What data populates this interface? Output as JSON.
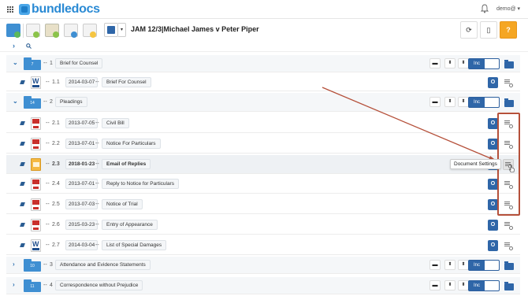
{
  "app": {
    "logo_text": "bundledocs",
    "user_label": "demo@ ▾",
    "doc_title": "JAM 12/3|Michael James v Peter Piper",
    "tooltip": "Document Settings"
  },
  "rows": [
    {
      "type": "section",
      "num": "1",
      "folder": "7",
      "label": "Brief for Counsel"
    },
    {
      "type": "doc",
      "file": "word",
      "num": "1.1",
      "date": "2014-03-07",
      "label": "Brief For Counsel"
    },
    {
      "type": "section",
      "num": "2",
      "folder": "14",
      "label": "Pleadings"
    },
    {
      "type": "doc",
      "file": "pdf",
      "num": "2.1",
      "date": "2013-07-05",
      "label": "Civil Bill"
    },
    {
      "type": "doc",
      "file": "pdf",
      "num": "2.2",
      "date": "2013-07-01",
      "label": "Notice For Particulars"
    },
    {
      "type": "doc",
      "file": "email",
      "num": "2.3",
      "date": "2018-01-23",
      "label": "Email of Replies"
    },
    {
      "type": "doc",
      "file": "pdf",
      "num": "2.4",
      "date": "2013-07-01",
      "label": "Reply to Notice for Particulars"
    },
    {
      "type": "doc",
      "file": "pdf",
      "num": "2.5",
      "date": "2013-07-03",
      "label": "Notice of Trial"
    },
    {
      "type": "doc",
      "file": "pdf",
      "num": "2.6",
      "date": "2015-03-23",
      "label": "Entry of Appearance"
    },
    {
      "type": "doc",
      "file": "word",
      "num": "2.7",
      "date": "2014-03-04",
      "label": "List of Special Damages"
    },
    {
      "type": "section",
      "num": "3",
      "folder": "10",
      "label": "Attendance and Evidence Statements"
    },
    {
      "type": "section",
      "num": "4",
      "folder": "11",
      "label": "Correspondence without Prejudice"
    }
  ],
  "labels": {
    "inc": "Inc",
    "toggle": "O",
    "word_letter": "W",
    "chev_down": "⌄",
    "chev_right": "›",
    "dash": "--",
    "date_dash": "--",
    "speech": "▬",
    "sort": "⬍",
    "refresh": "⟳",
    "panel": "▯",
    "help": "?"
  },
  "colors": {
    "brand_blue": "#2a8ad4",
    "folder_blue": "#3f8fd2",
    "toggle_blue": "#2f66a8",
    "help_orange": "#f5a623",
    "annotation_red": "#b5503a"
  }
}
